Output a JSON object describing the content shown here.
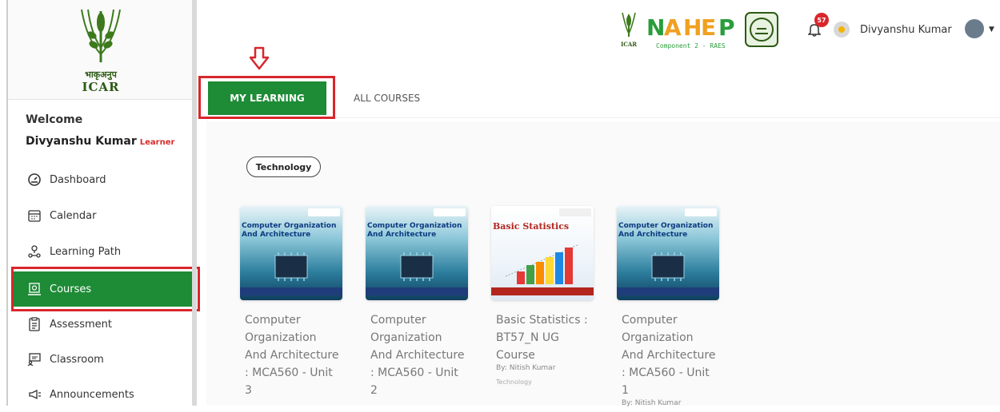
{
  "sidebar": {
    "logo_hindi": "भाकृअनुप",
    "logo_english": "ICAR",
    "welcome": "Welcome",
    "user_name": "Divyanshu Kumar",
    "user_role": "Learner",
    "items": [
      {
        "label": "Dashboard",
        "icon": "dashboard-icon"
      },
      {
        "label": "Calendar",
        "icon": "calendar-icon"
      },
      {
        "label": "Learning Path",
        "icon": "learning-path-icon"
      },
      {
        "label": "Courses",
        "icon": "courses-icon",
        "active": true
      },
      {
        "label": "Assessment",
        "icon": "assessment-icon"
      },
      {
        "label": "Classroom",
        "icon": "classroom-icon"
      },
      {
        "label": "Announcements",
        "icon": "announcements-icon"
      }
    ]
  },
  "header": {
    "nhep_text": "NAHEP",
    "nhep_sub": "Component 2 - RAES",
    "icar_small": "ICAR",
    "notification_count": "57",
    "user_name": "Divyanshu Kumar"
  },
  "tabs": {
    "my_learning": "MY LEARNING",
    "all_courses": "ALL COURSES"
  },
  "filter_chip": "Technology",
  "courses": [
    {
      "thumb_title": "Computer Organization And Architecture",
      "title": "Computer Organization And Architecture : MCA560 - Unit 3",
      "author": "",
      "category": ""
    },
    {
      "thumb_title": "Computer Organization And Architecture",
      "title": "Computer Organization And Architecture : MCA560 - Unit 2",
      "author": "",
      "category": ""
    },
    {
      "thumb_title": "Basic Statistics",
      "title": "Basic Statistics : BT57_N UG Course",
      "author": "By: Nitish Kumar",
      "category": "Technology"
    },
    {
      "thumb_title": "Computer Organization And Architecture",
      "title": "Computer Organization And Architecture : MCA560 - Unit 1",
      "author": "By: Nitish Kumar",
      "category": ""
    }
  ],
  "colors": {
    "accent_green": "#1e8b36",
    "highlight_red": "#d9262c"
  }
}
